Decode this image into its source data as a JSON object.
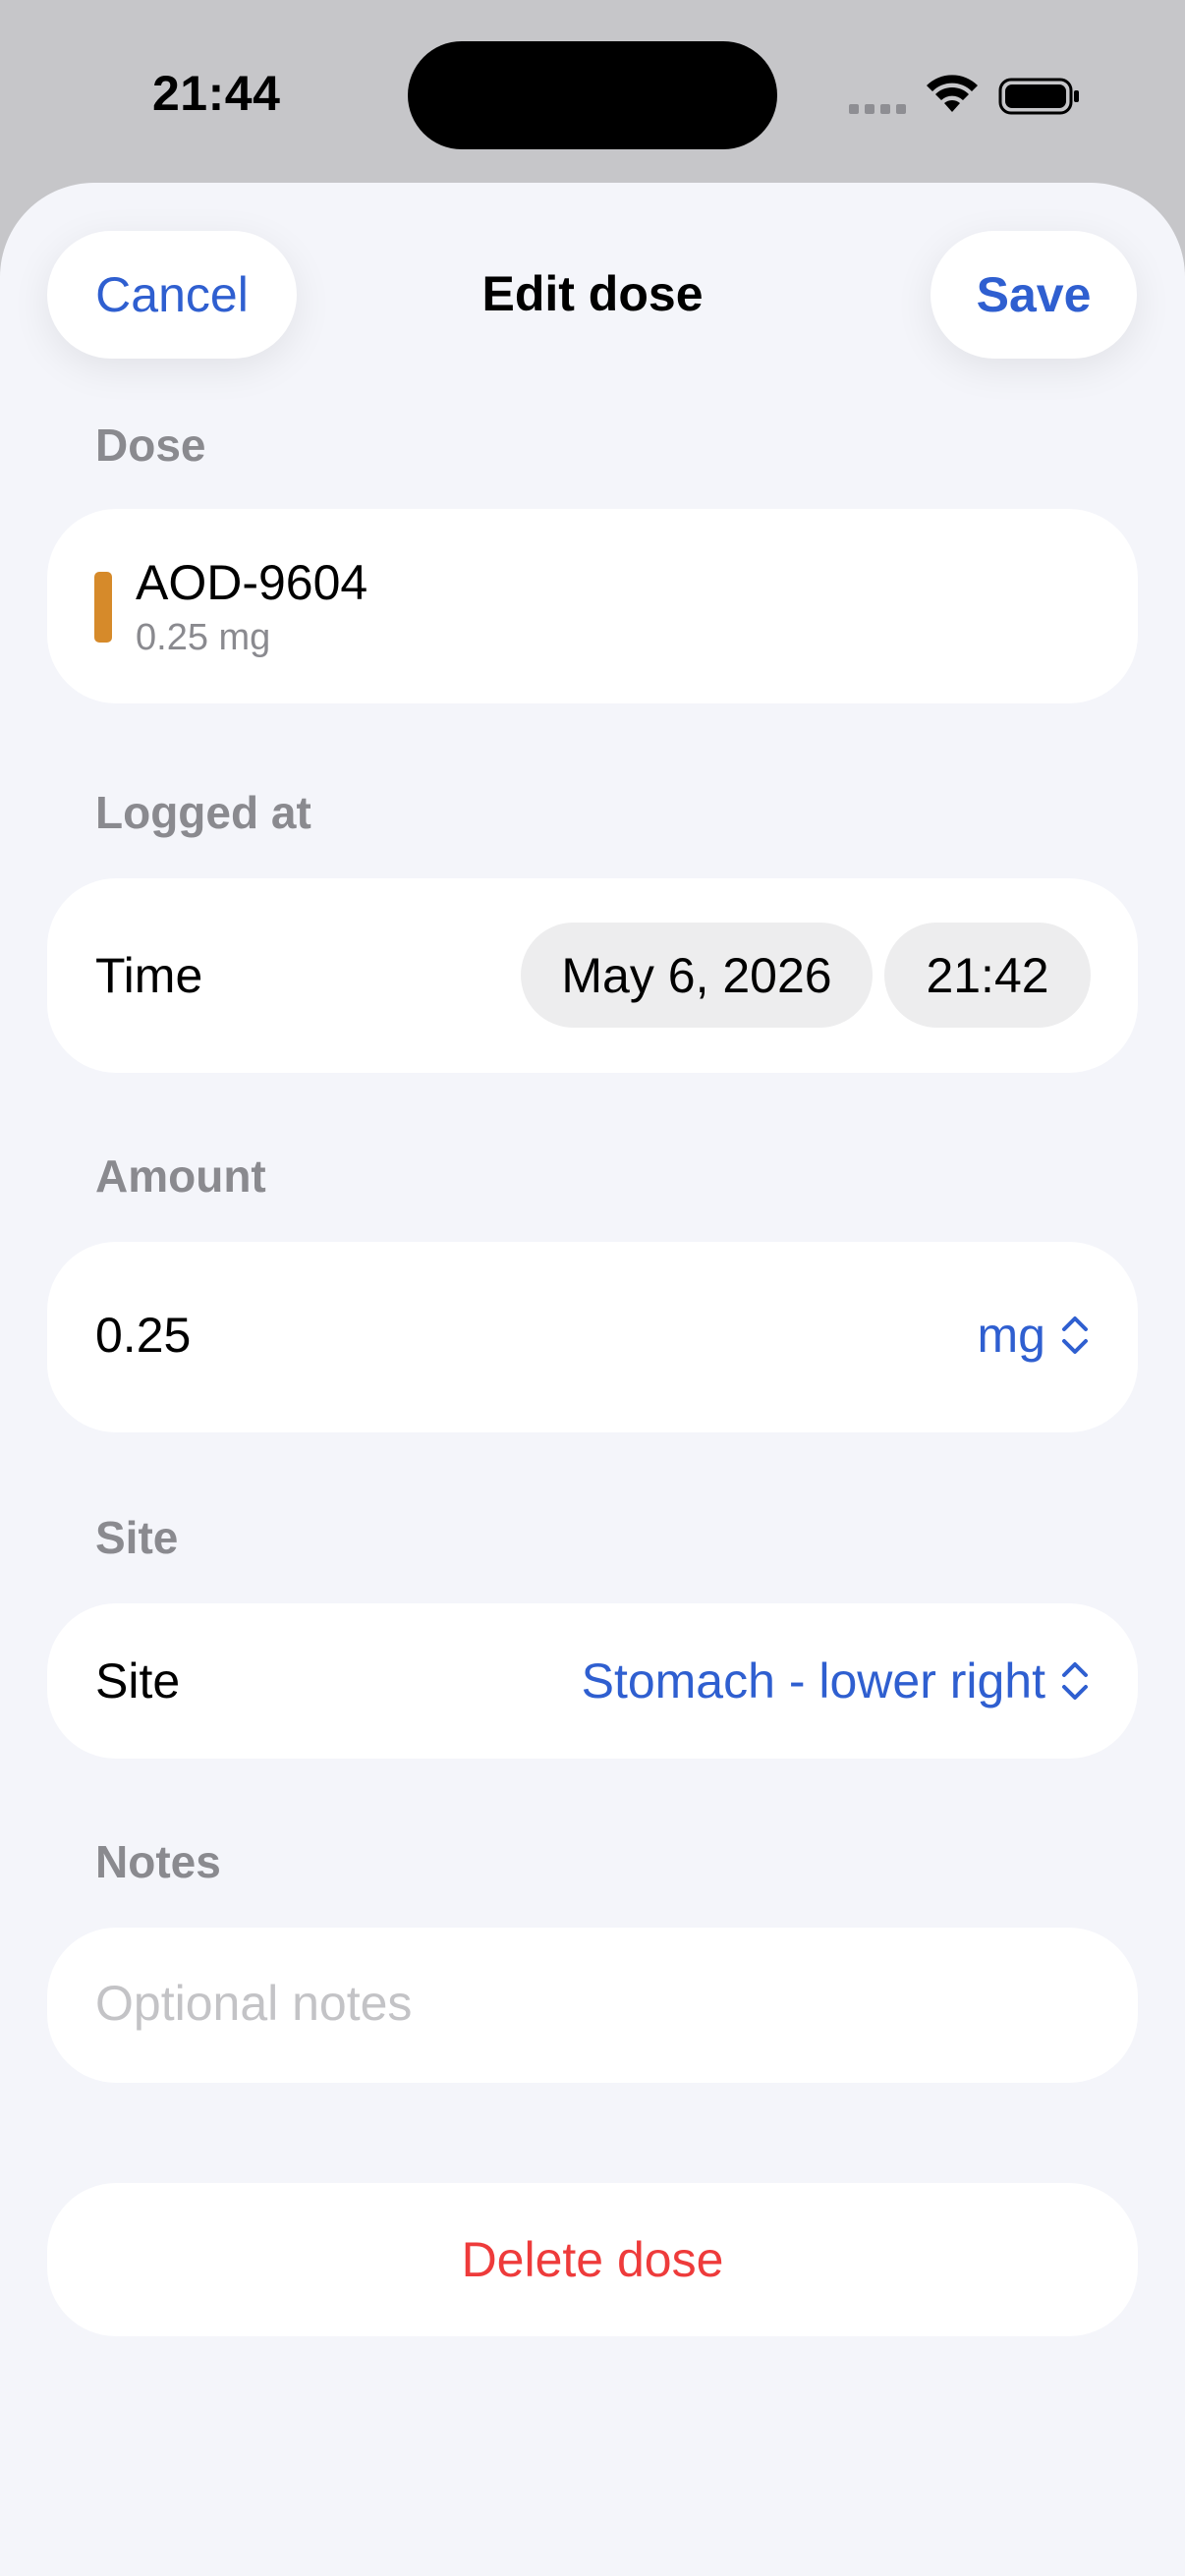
{
  "status_bar": {
    "time": "21:44",
    "icons": [
      "cellular-signal-icon",
      "wifi-icon",
      "battery-icon"
    ]
  },
  "header": {
    "title": "Edit dose",
    "cancel_label": "Cancel",
    "save_label": "Save"
  },
  "dose_section": {
    "label": "Dose",
    "name": "AOD-9604",
    "amount": "0.25 mg",
    "accent_color": "#d68a2a"
  },
  "logged_section": {
    "label": "Logged at",
    "row_label": "Time",
    "date": "May 6, 2026",
    "time": "21:42"
  },
  "amount_section": {
    "label": "Amount",
    "value": "0.25",
    "unit": "mg"
  },
  "site_section": {
    "label": "Site",
    "row_label": "Site",
    "value": "Stomach - lower right"
  },
  "notes_section": {
    "label": "Notes",
    "value": "",
    "placeholder": "Optional notes"
  },
  "delete_label": "Delete dose",
  "colors": {
    "accent_blue": "#2f5fd0",
    "destructive_red": "#ee3b3b",
    "background": "#f4f5fa"
  }
}
